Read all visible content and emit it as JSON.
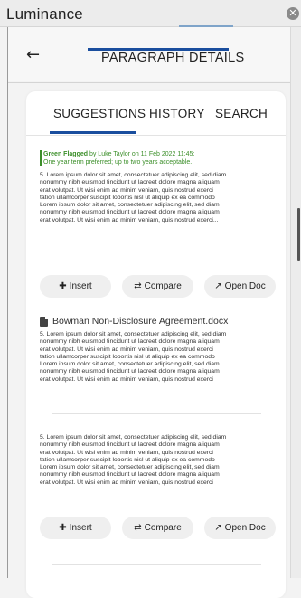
{
  "app": {
    "title": "Luminance"
  },
  "header": {
    "title": "PARAGRAPH DETAILS"
  },
  "tabs": [
    {
      "label": "SUGGESTIONS"
    },
    {
      "label": "HISTORY"
    },
    {
      "label": "SEARCH"
    }
  ],
  "cards": [
    {
      "flag": {
        "status": "Green Flagged",
        "byline": "by Luke Taylor on 11 Feb 2022 11:45:",
        "note": "One year term preferred; up to two years acceptable."
      },
      "lines": [
        "5. Lorem ipsum dolor sit amet, consectetuer adipiscing elit, sed diam",
        "nonummy nibh euismod tincidunt ut laoreet dolore magna aliquam",
        "erat volutpat. Ut wisi enim ad minim veniam, quis nostrud exerci",
        "tation ullamcorper suscipit lobortis nisl ut aliquip ex ea commodo",
        "Lorem ipsum dolor sit amet, consectetuer adipiscing elit, sed diam",
        "nonummy nibh euismod tincidunt ut laoreet dolore magna aliquam",
        "erat volutpat. Ut wisi enim ad minim veniam, quis nostrud exerci..."
      ],
      "document": "Bowman Non-Disclosure Agreement.docx"
    },
    {
      "lines": [
        "5. Lorem ipsum dolor sit amet, consectetuer adipiscing elit, sed diam",
        "nonummy nibh euismod tincidunt ut laoreet dolore magna aliquam",
        "erat volutpat. Ut wisi enim ad minim veniam, quis nostrud exerci",
        "tation ullamcorper suscipit lobortis nisl ut aliquip ex ea commodo",
        "Lorem ipsum dolor sit amet, consectetuer adipiscing elit, sed diam",
        "nonummy nibh euismod tincidunt ut laoreet dolore magna aliquam",
        "erat volutpat. Ut wisi enim ad minim veniam, quis nostrud exerci"
      ]
    },
    {
      "lines": [
        "5. Lorem ipsum dolor sit amet, consectetuer adipiscing elit, sed diam",
        "nonummy nibh euismod tincidunt ut laoreet dolore magna aliquam",
        "erat volutpat. Ut wisi enim ad minim veniam, quis nostrud exerci",
        "tation ullamcorper suscipit lobortis nisl ut aliquip ex ea commodo",
        "Lorem ipsum dolor sit amet, consectetuer adipiscing elit, sed diam",
        "nonummy nibh euismod tincidunt ut laoreet dolore magna aliquam",
        "erat volutpat. Ut wisi enim ad minim veniam, quis nostrud exerci"
      ]
    }
  ],
  "actions": {
    "insert_label": "Insert",
    "compare_label": "Compare",
    "open_doc_label": "Open Doc"
  },
  "colors": {
    "accent": "#1a4e9e",
    "flag_green": "#3c8f2a"
  }
}
